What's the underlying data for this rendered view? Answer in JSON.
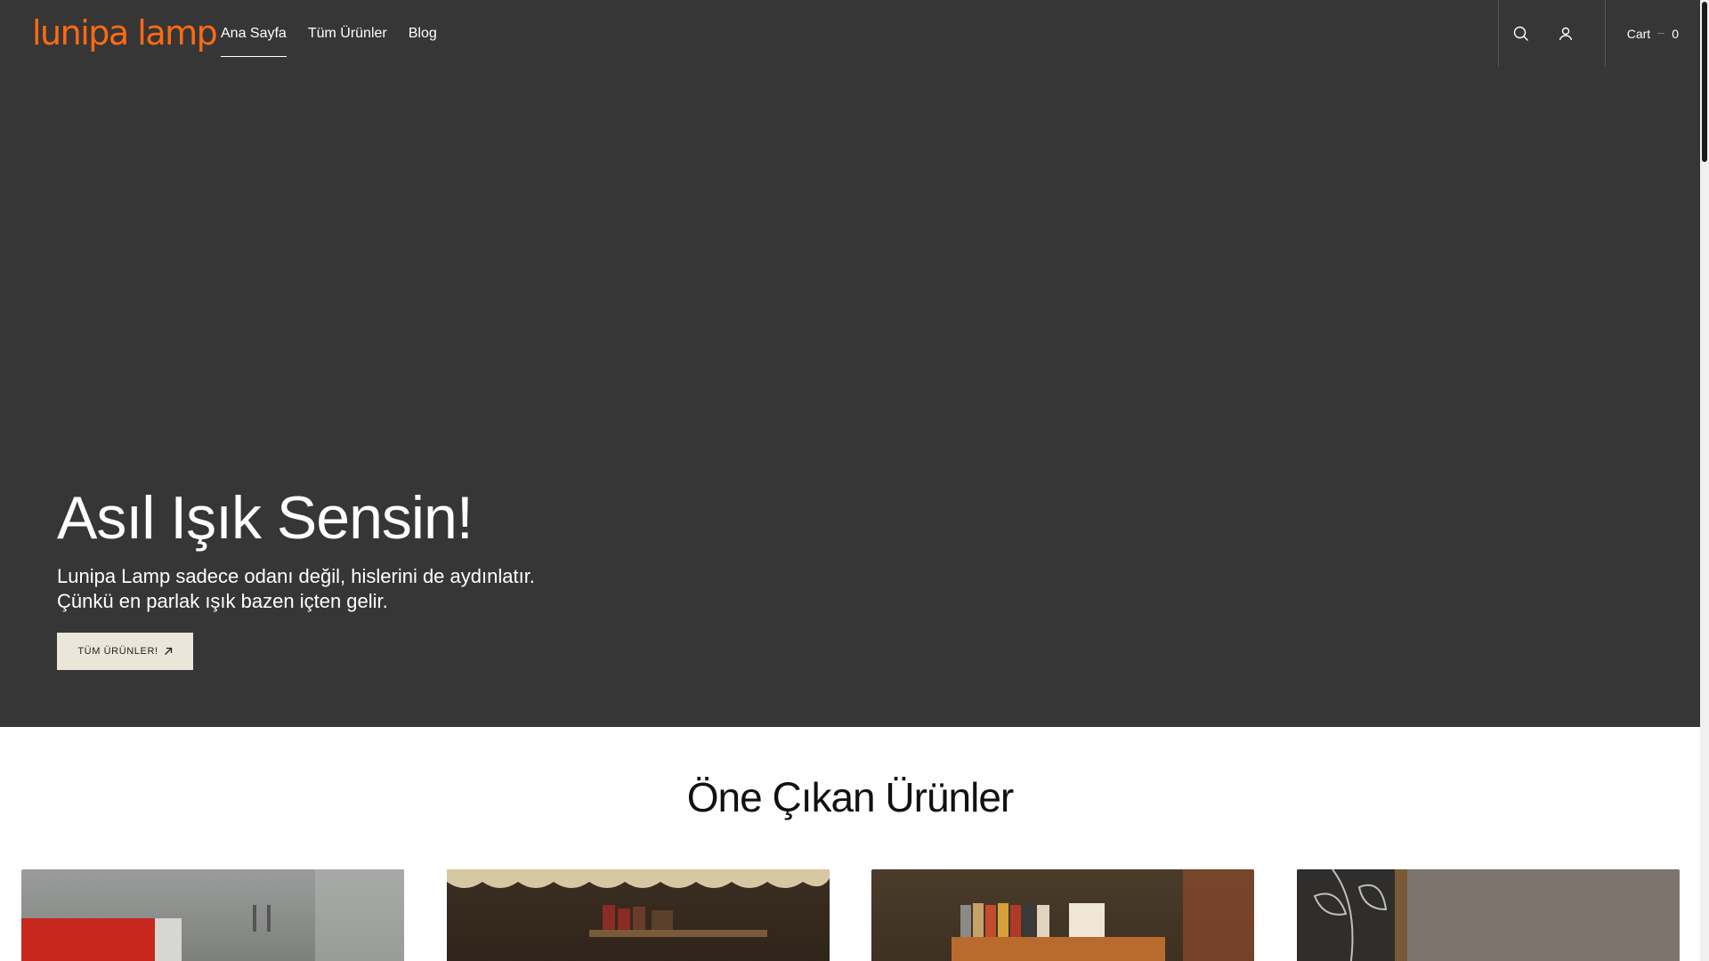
{
  "brand": {
    "logo_text": "lunipa lamp",
    "accent": "#ff6a13"
  },
  "nav": {
    "items": [
      {
        "label": "Ana Sayfa",
        "active": true
      },
      {
        "label": "Tüm Ürünler",
        "active": false
      },
      {
        "label": "Blog",
        "active": false
      }
    ]
  },
  "header": {
    "search_icon": "search-icon",
    "account_icon": "user-icon",
    "cart_label": "Cart",
    "cart_count": "0"
  },
  "hero": {
    "background": "#363636",
    "title": "Asıl Işık Sensin!",
    "text": "Lunipa Lamp sadece odanı değil, hislerini de aydınlatır. Çünkü en parlak ışık bazen içten gelir.",
    "cta_label": "TÜM ÜRÜNLER!",
    "cta_icon": "arrow-up-right-icon"
  },
  "featured": {
    "title": "Öne Çıkan Ürünler"
  }
}
